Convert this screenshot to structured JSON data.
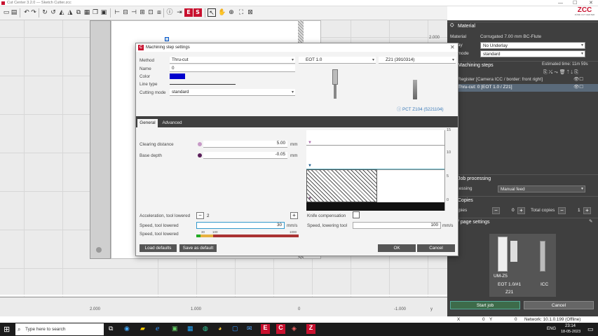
{
  "window": {
    "title": "Cut Center 3.2.0 — Sketch Cutter.zcc",
    "min": "—",
    "max": "☐",
    "close": "✕"
  },
  "logo": {
    "text": "ZCC",
    "sub": "ZÜND CUT CENTER"
  },
  "canvas": {
    "ruler_x": [
      "2.000",
      "1.000",
      "0",
      "-1.000"
    ],
    "ruler_y_top": "2.000",
    "axis_y": "y"
  },
  "rpanel": {
    "material_header": "Material",
    "material_label": "Material",
    "material_value": "Corrugated 7.00 mm BC-Flute",
    "underlay_label": "derlay",
    "underlay_value": "No Underlay",
    "mode_label": "ing mode",
    "mode_value": "standard",
    "steps_header": "Machining steps",
    "est_time": "Estimated time: 11m 59s",
    "step1": "Register [Camera ICC / border: front right]",
    "step2": "Thru-cut: 0 [EOT 1.0 / Z21]",
    "job_header": "Job processing",
    "job_label": "processing",
    "job_value": "Manual feed",
    "copies_header": "Copies",
    "copies_label": "e copies",
    "copies_value": "0",
    "total_label": "Total copies",
    "total_value": "1",
    "page_header": "/ page settings",
    "tool_name": "UM-Z5",
    "tool_sub": "EOT 1.0/#1",
    "tool_bit": "Z21",
    "cam": "ICC",
    "start": "Start job",
    "cancel": "Cancel"
  },
  "status": {
    "x_label": "X",
    "x_value": "0",
    "y_label": "Y",
    "y_value": "0",
    "network": "Network: 10.1.0.199 (Offline)"
  },
  "taskbar": {
    "search": "Type here to search",
    "time": "23:14",
    "date": "18-05-2023",
    "lang": "ENG"
  },
  "dialog": {
    "title": "Machining step settings",
    "method_label": "Method",
    "method_value": "Thru-cut",
    "tool_value": "EOT 1.0",
    "bit_value": "Z21 (3910314)",
    "name_label": "Name",
    "name_value": "0",
    "color_label": "Color",
    "color_value": "#0000cc",
    "linetype_label": "Line type",
    "cutmode_label": "Cutting mode",
    "cutmode_value": "standard",
    "pct_link": "PCT Z104 (5221104)",
    "tabs": [
      "General",
      "Advanced"
    ],
    "clearing_label": "Clearing distance",
    "clearing_value": "5.00",
    "clearing_unit": "mm",
    "base_label": "Base depth",
    "base_value": "-0.05",
    "base_unit": "mm",
    "chart_ticks": [
      "15",
      "10",
      "5",
      "0"
    ],
    "accel_label": "Acceleration, tool lowered",
    "accel_value": "2",
    "knife_label": "Knife compensation",
    "speed_label": "Speed, tool lowered",
    "speed_value": "30",
    "speed_unit": "mm/s",
    "speed2_label": "Speed, lowering tool",
    "speed2_value": "100",
    "speed2_unit": "mm/s",
    "speed3_label": "Speed, tool lowered",
    "bar_ticks": [
      "30",
      "100",
      "1000"
    ],
    "load": "Load defaults",
    "save": "Save as default",
    "ok": "OK",
    "cancel": "Cancel"
  }
}
